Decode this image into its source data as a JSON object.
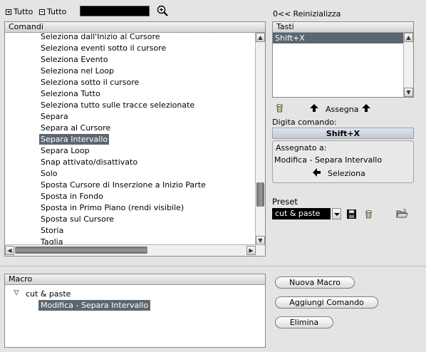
{
  "toolbar": {
    "expand_all": "Tutto",
    "collapse_all": "Tutto",
    "search_value": ""
  },
  "commands": {
    "header": "Comandi",
    "items": [
      "Seleziona dall'Inizio al Cursore",
      "Seleziona eventi sotto il cursore",
      "Seleziona Evento",
      "Seleziona nel Loop",
      "Seleziona sotto il cursore",
      "Seleziona Tutto",
      "Seleziona tutto sulle tracce selezionate",
      "Separa",
      "Separa al Cursore",
      "Separa Intervallo",
      "Separa Loop",
      "Snap attivato/disattivato",
      "Solo",
      "Sposta Cursore di Inserzione a Inizio Parte",
      "Sposta in Fondo",
      "Sposta in Primo Piano (rendi visibile)",
      "Sposta sul Cursore",
      "Storia",
      "Taglia"
    ],
    "selected": "Separa Intervallo"
  },
  "keys": {
    "reset_glyph": "0<<",
    "reset_label": "Reinizializza",
    "header": "Tasti",
    "items": [
      "Shift+X"
    ],
    "assign_label": "Assegna",
    "type_command_label": "Digita comando:",
    "typed_shortcut": "Shift+X",
    "assigned_to_label": "Assegnato a:",
    "assigned_to_value": "Modifica - Separa Intervallo",
    "select_label": "Seleziona"
  },
  "preset": {
    "label": "Preset",
    "selected": "cut & paste"
  },
  "macro": {
    "header": "Macro",
    "group": "cut & paste",
    "item": "Modifica - Separa Intervallo",
    "buttons": {
      "new": "Nuova Macro",
      "add": "Aggiungi Comando",
      "delete": "Elimina"
    }
  }
}
